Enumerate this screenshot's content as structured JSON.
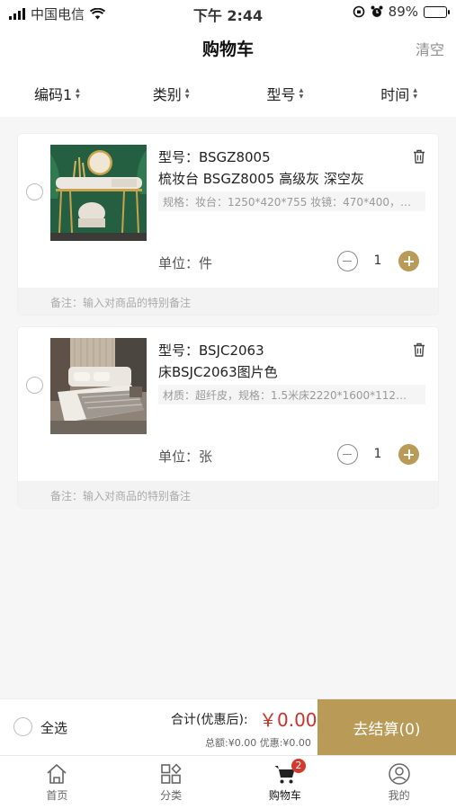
{
  "status_bar": {
    "carrier": "中国电信",
    "time": "下午 2:44",
    "battery": "89%",
    "battery_level": 0.89
  },
  "header": {
    "title": "购物车",
    "clear_label": "清空"
  },
  "sort_bar": [
    {
      "label": "编码1"
    },
    {
      "label": "类别"
    },
    {
      "label": "型号"
    },
    {
      "label": "时间"
    }
  ],
  "cart_items": [
    {
      "model": "型号：BSGZ8005",
      "name": "梳妆台 BSGZ8005 高级灰 深空灰",
      "spec": "规格：妆台：1250*420*755 妆镜：470*400，…",
      "unit": "单位：件",
      "quantity": "1",
      "remark_placeholder": "备注：输入对商品的特别备注"
    },
    {
      "model": "型号：BSJC2063",
      "name": "床BSJC2063图片色",
      "spec": "材质：超纤皮，规格：1.5米床2220*1600*112…",
      "unit": "单位：张",
      "quantity": "1",
      "remark_placeholder": "备注：输入对商品的特别备注"
    }
  ],
  "checkout": {
    "select_all_label": "全选",
    "total_label": "合计(优惠后):",
    "total_amount": "￥0.00",
    "sub_amounts": "总额:¥0.00 优惠:¥0.00",
    "button_label": "去结算(0)"
  },
  "tab_bar": [
    {
      "label": "首页",
      "icon": "home-icon"
    },
    {
      "label": "分类",
      "icon": "category-icon"
    },
    {
      "label": "购物车",
      "icon": "cart-icon",
      "badge": "2"
    },
    {
      "label": "我的",
      "icon": "profile-icon"
    }
  ],
  "colors": {
    "accent": "#b99a57",
    "price": "#c8322b",
    "badge": "#d33a2f"
  }
}
